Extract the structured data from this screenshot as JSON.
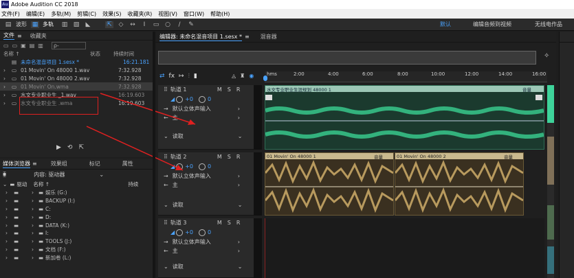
{
  "app": {
    "title": "Adobe Audition CC 2018",
    "icon_label": "Au"
  },
  "menu": [
    "文件(F)",
    "编辑(E)",
    "多轨(M)",
    "剪辑(C)",
    "效果(S)",
    "收藏夹(R)",
    "视图(V)",
    "窗口(W)",
    "帮助(H)"
  ],
  "toolbar": {
    "waveform_label": "波形",
    "multitrack_label": "多轨",
    "workspace_default": "默认",
    "workspace_edit": "编辑音频到视频",
    "radio_production": "无线电作品"
  },
  "files_panel": {
    "tab_files": "文件",
    "tab_favorites": "收藏夹",
    "search_placeholder": "ρ-",
    "col_name": "名称 ↑",
    "col_status": "状态",
    "col_duration": "持续时间",
    "rows": [
      {
        "name": "未命名混音项目 1.sesx *",
        "duration": "16:21.181"
      },
      {
        "name": "01 Movin' On 48000 1.wav",
        "duration": "7:32.928"
      },
      {
        "name": "01 Movin' On 48000 2.wav",
        "duration": "7:32.928"
      },
      {
        "name": "01 Movin' On.wma",
        "duration": "7:32.928"
      },
      {
        "name": "水文专业职业生 _1.wav",
        "duration": "16:19.603"
      },
      {
        "name": "水文专业职业生 .wma",
        "duration": "16:19.603"
      }
    ]
  },
  "media_panel": {
    "tab_media": "媒体浏览器",
    "tab_effects": "效果组",
    "tab_markers": "标记",
    "tab_properties": "属性",
    "content_label": "内容: 驱动器",
    "col_name": "名称 ↑",
    "col_duration": "持续",
    "tree_root": "驱动",
    "drives": [
      "娱乐 (G:)",
      "BACKUP (I:)",
      "C:",
      "D:",
      "DATA (K:)",
      "I:",
      "TOOLS (J:)",
      "文档 (F:)",
      "新加卷 (L:)"
    ]
  },
  "editor": {
    "tab_editor": "编辑器: 未命名混音项目 1.sesx *",
    "tab_mixer": "混音器",
    "ruler_labels": [
      "hms",
      "2:00",
      "4:00",
      "6:00",
      "8:00",
      "10:00",
      "12:00",
      "14:00",
      "16:00"
    ]
  },
  "tracks": [
    {
      "name": "轨道 1",
      "volume": "+0",
      "pan": "0",
      "input": "默认立体声输入",
      "output": "主",
      "mode": "读取",
      "clip_name": "水文专业职业生涯规划 48000 1",
      "clip_volume": "音量",
      "clip_color": "#33b27d"
    },
    {
      "name": "轨道 2",
      "volume": "+0",
      "pan": "0",
      "input": "默认立体声输入",
      "output": "主",
      "mode": "读取",
      "clip_name": "01 Movin' On 48000 1",
      "clip_volume": "音量",
      "clip2_name": "01 Movin' On 48000 2",
      "clip2_volume": "音量",
      "clip_color": "#b89a5e"
    },
    {
      "name": "轨道 3",
      "volume": "+0",
      "pan": "0",
      "input": "默认立体声输入",
      "output": "主",
      "mode": "读取"
    }
  ],
  "track_buttons": {
    "mute": "M",
    "solo": "S",
    "record": "R"
  },
  "colors": {
    "accent": "#4aa3ff",
    "annotation": "#e02020"
  }
}
